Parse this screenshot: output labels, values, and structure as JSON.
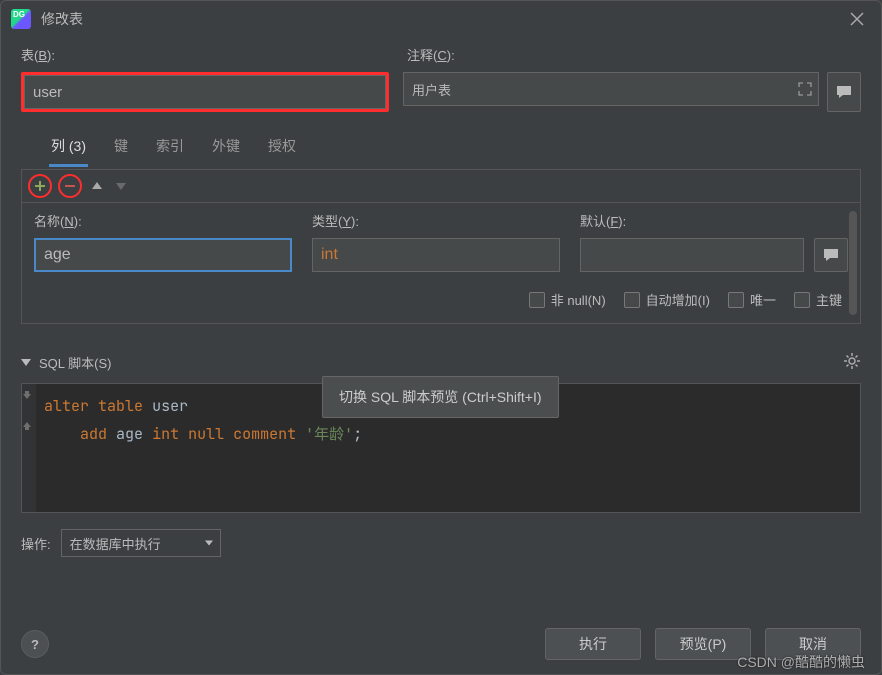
{
  "window": {
    "title": "修改表"
  },
  "labels": {
    "table_prefix": "表(",
    "table_key": "B",
    "table_suffix": "):",
    "comment_prefix": "注释(",
    "comment_key": "C",
    "comment_suffix": "):"
  },
  "fields": {
    "table_name": "user",
    "comment": "用户表"
  },
  "tabs": [
    {
      "label": "列 (3)",
      "active": true
    },
    {
      "label": "键"
    },
    {
      "label": "索引"
    },
    {
      "label": "外键"
    },
    {
      "label": "授权"
    }
  ],
  "column": {
    "labels": {
      "name_prefix": "名称(",
      "name_key": "N",
      "name_suffix": "):",
      "type_prefix": "类型(",
      "type_key": "Y",
      "type_suffix": "):",
      "default_prefix": "默认(",
      "default_key": "F",
      "default_suffix": "):"
    },
    "name": "age",
    "type": "int",
    "default": "",
    "checks": {
      "notnull_prefix": "非 null(",
      "notnull_key": "N",
      "notnull_suffix": ")",
      "auto_prefix": "自动增加(",
      "auto_key": "I",
      "auto_suffix": ")",
      "unique": "唯一",
      "pk": "主键"
    }
  },
  "sql": {
    "header_prefix": "SQL 脚本(",
    "header_key": "S",
    "header_suffix": ")",
    "tooltip": "切换 SQL 脚本预览 (Ctrl+Shift+I)",
    "line1": {
      "kw1": "alter",
      "kw2": "table",
      "ident": "user"
    },
    "line2": {
      "indent": "    ",
      "kw1": "add",
      "ident1": "age",
      "type": "int",
      "kw2": "null",
      "kw3": "comment",
      "str": "'年龄'",
      "semi": ";"
    }
  },
  "ops": {
    "label": "操作:",
    "selected": "在数据库中执行"
  },
  "footer": {
    "execute": "执行",
    "preview_prefix": "预览(",
    "preview_key": "P",
    "preview_suffix": ")",
    "cancel": "取消"
  },
  "watermark": "CSDN @酷酷的懒虫",
  "icons": {
    "app": "DG"
  }
}
